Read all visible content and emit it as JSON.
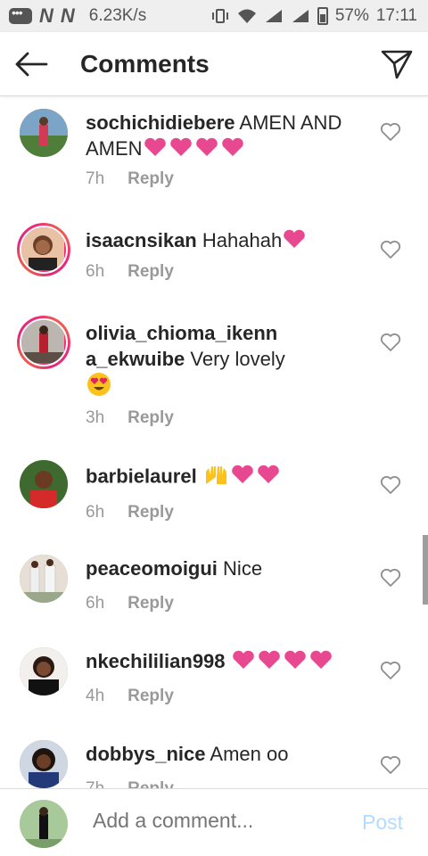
{
  "status_bar": {
    "speed": "6.23K/s",
    "battery": "57%",
    "time": "17:11",
    "n1": "N",
    "n2": "N"
  },
  "header": {
    "title": "Comments",
    "back_icon": "arrow-left-icon",
    "send_icon": "paper-plane-icon"
  },
  "comments": [
    {
      "username": "sochichidiebere",
      "text": "AMEN AND AMEN",
      "emojis": "❤❤❤❤",
      "time": "7h",
      "reply": "Reply"
    },
    {
      "username": "isaacnsikan",
      "text": "Hahahah",
      "emojis": "❤",
      "time": "6h",
      "reply": "Reply"
    },
    {
      "username": "olivia_chioma_ikenna_ekwuibe",
      "username_line1": "olivia_chioma_ikenn",
      "username_line2": "a_ekwuibe",
      "text": "Very lovely",
      "emojis": "😍",
      "time": "3h",
      "reply": "Reply"
    },
    {
      "username": "barbielaurel",
      "text": "",
      "emojis": "🙌❤❤",
      "time": "6h",
      "reply": "Reply"
    },
    {
      "username": "peaceomoigui",
      "text": "Nice",
      "emojis": "",
      "time": "6h",
      "reply": "Reply"
    },
    {
      "username": "nkechililian998",
      "text": "",
      "emojis": "❤❤❤❤",
      "time": "4h",
      "reply": "Reply"
    },
    {
      "username": "dobbys_nice",
      "text": "Amen oo",
      "emojis": "",
      "time": "7h",
      "reply": "Reply"
    }
  ],
  "composer": {
    "placeholder": "Add a comment...",
    "post_label": "Post"
  },
  "colors": {
    "heart": "#e8488f",
    "post_disabled": "#b3dbff",
    "meta": "#999999"
  }
}
